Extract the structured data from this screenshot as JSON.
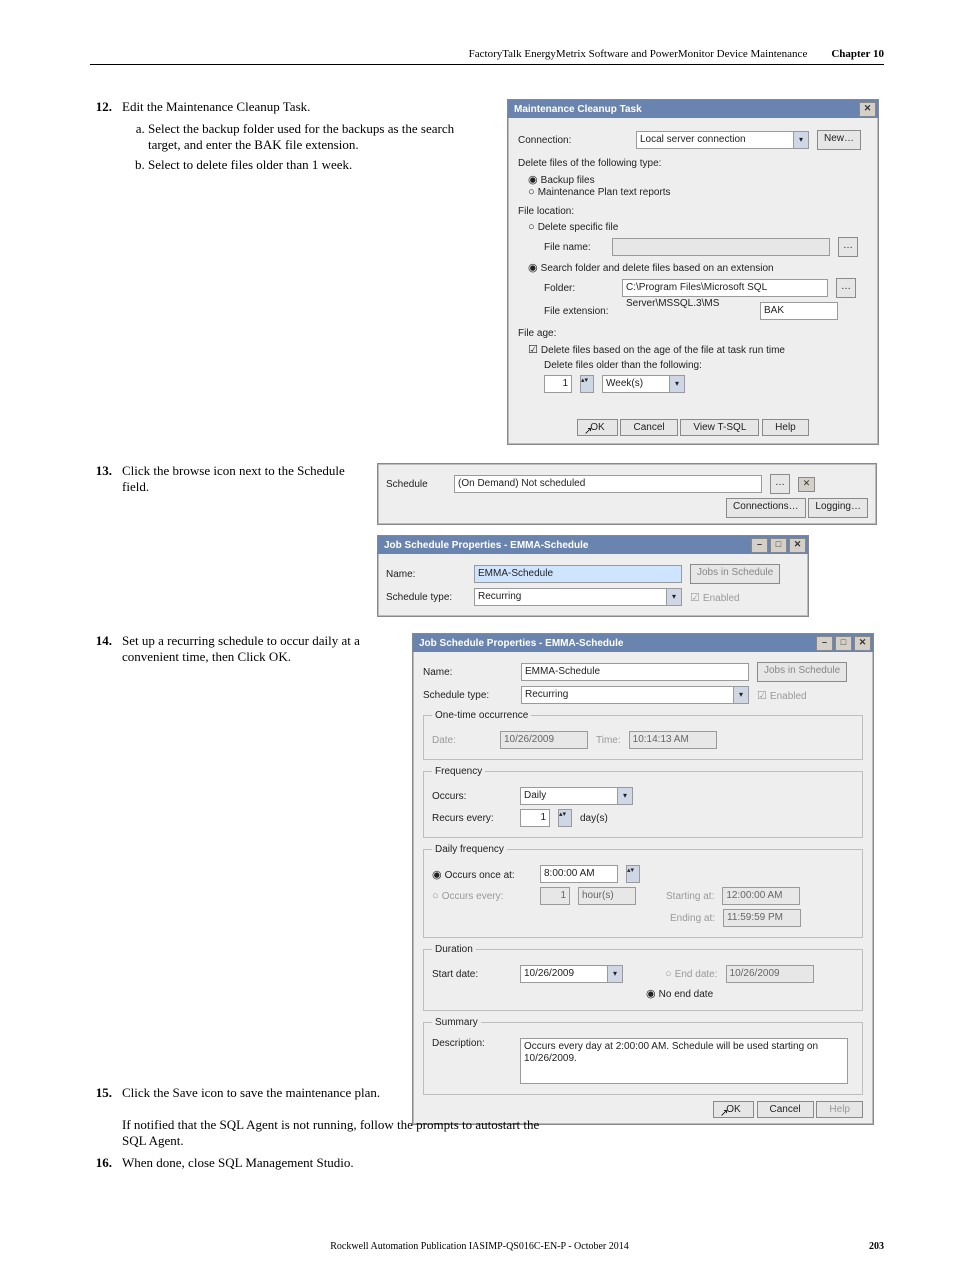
{
  "runningHead": {
    "title": "FactoryTalk EnergyMetrix Software and PowerMonitor Device Maintenance",
    "chapter": "Chapter 10"
  },
  "steps": {
    "s12": {
      "num": "12.",
      "text": "Edit the Maintenance Cleanup Task.",
      "a": "Select the backup folder used for the backups as the search target, and enter the BAK file extension.",
      "b": "Select to delete files older than 1 week."
    },
    "s13": {
      "num": "13.",
      "text": "Click the browse icon next to the Schedule field."
    },
    "s14": {
      "num": "14.",
      "text": "Set up a recurring schedule to occur daily at a convenient time, then Click OK."
    },
    "s15": {
      "num": "15.",
      "text": "Click the Save icon to save the maintenance plan.",
      "note": "If notified that the SQL Agent is not running, follow the prompts to autostart the SQL Agent."
    },
    "s16": {
      "num": "16.",
      "text": "When done, close SQL Management Studio."
    }
  },
  "dlgCleanup": {
    "title": "Maintenance Cleanup Task",
    "connectionLbl": "Connection:",
    "connection": "Local server connection",
    "newBtn": "New…",
    "deleteTypeLbl": "Delete files of the following type:",
    "optBackup": "Backup files",
    "optReports": "Maintenance Plan text reports",
    "fileLocationLbl": "File location:",
    "optSpecific": "Delete specific file",
    "fileNameLbl": "File name:",
    "browse": "…",
    "optSearch": "Search folder and delete files based on an extension",
    "folderLbl": "Folder:",
    "folder": "C:\\Program Files\\Microsoft SQL Server\\MSSQL.3\\MS",
    "extLbl": "File extension:",
    "ext": "BAK",
    "fileAgeLbl": "File age:",
    "chkAge": "Delete files based on the age of the file at task run time",
    "olderThan": "Delete files older than the following:",
    "ageNum": "1",
    "ageUnit": "Week(s)",
    "ok": "OK",
    "cancel": "Cancel",
    "viewT": "View T-SQL",
    "help": "Help"
  },
  "scheduleStrip": {
    "scheduleLbl": "Schedule",
    "value": "(On Demand) Not scheduled",
    "browseTip": "…",
    "close": "✕",
    "connections": "Connections…",
    "logging": "Logging…"
  },
  "dlgSchedSmall": {
    "title": "Job Schedule Properties - EMMA-Schedule",
    "nameLbl": "Name:",
    "name": "EMMA-Schedule",
    "jobsBtn": "Jobs in Schedule",
    "typeLbl": "Schedule type:",
    "type": "Recurring",
    "enabled": "Enabled"
  },
  "dlgSched": {
    "title": "Job Schedule Properties - EMMA-Schedule",
    "nameLbl": "Name:",
    "name": "EMMA-Schedule",
    "jobsBtn": "Jobs in Schedule",
    "typeLbl": "Schedule type:",
    "type": "Recurring",
    "enabled": "Enabled",
    "oneTimeLegend": "One-time occurrence",
    "dateLbl": "Date:",
    "date": "10/26/2009",
    "timeLbl": "Time:",
    "time": "10:14:13 AM",
    "freqLegend": "Frequency",
    "occursLbl": "Occurs:",
    "occurs": "Daily",
    "recursLbl": "Recurs every:",
    "recursNum": "1",
    "recursUnit": "day(s)",
    "dailyFreqLegend": "Daily frequency",
    "occursOnceLbl": "Occurs once at:",
    "occursOnce": "8:00:00 AM",
    "occursEveryLbl": "Occurs every:",
    "occursEveryNum": "1",
    "occursEveryUnit": "hour(s)",
    "startingAtLbl": "Starting at:",
    "startingAt": "12:00:00 AM",
    "endingAtLbl": "Ending at:",
    "endingAt": "11:59:59 PM",
    "durationLegend": "Duration",
    "startDateLbl": "Start date:",
    "startDate": "10/26/2009",
    "endDateLbl": "End date:",
    "endDate": "10/26/2009",
    "noEndLbl": "No end date",
    "summaryLegend": "Summary",
    "descLbl": "Description:",
    "desc": "Occurs every day at 2:00:00 AM. Schedule will be used starting on 10/26/2009.",
    "ok": "OK",
    "cancel": "Cancel",
    "help": "Help"
  },
  "footer": {
    "pub": "Rockwell Automation Publication IASIMP-QS016C-EN-P - October 2014",
    "page": "203"
  }
}
